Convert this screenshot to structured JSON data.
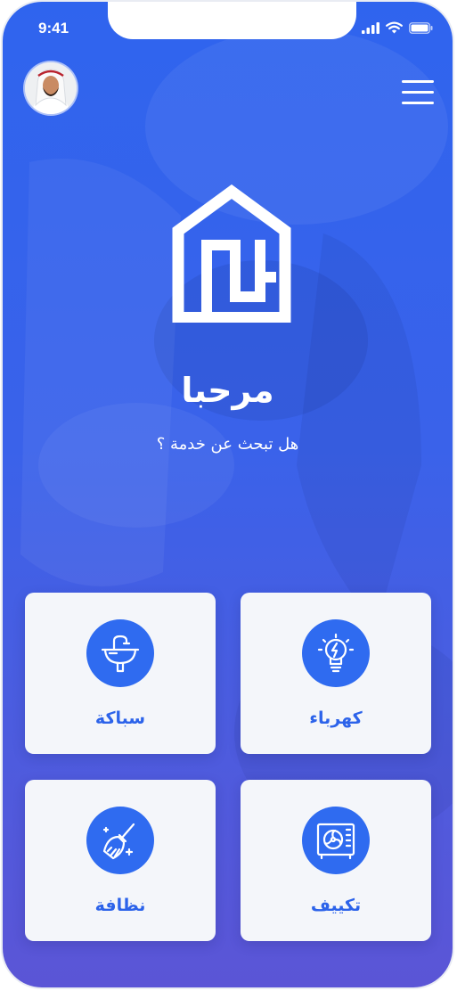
{
  "status_bar": {
    "time": "9:41"
  },
  "header": {
    "avatar_icon": "user-avatar",
    "menu_icon": "hamburger-menu-icon"
  },
  "hero": {
    "logo_icon": "house-logo-icon",
    "title": "مرحبا",
    "subtitle": "هل تبحث عن خدمة ؟"
  },
  "services": [
    {
      "label": "كهرباء",
      "icon": "lightbulb-icon"
    },
    {
      "label": "سباكة",
      "icon": "sink-icon"
    },
    {
      "label": "تكييف",
      "icon": "air-conditioner-icon"
    },
    {
      "label": "نظافة",
      "icon": "cleaning-brush-icon"
    }
  ],
  "colors": {
    "primary": "#2f6bf0",
    "gradient_top": "#2f64ee",
    "gradient_bottom": "#5b55d6",
    "card": "#f4f6fa"
  }
}
